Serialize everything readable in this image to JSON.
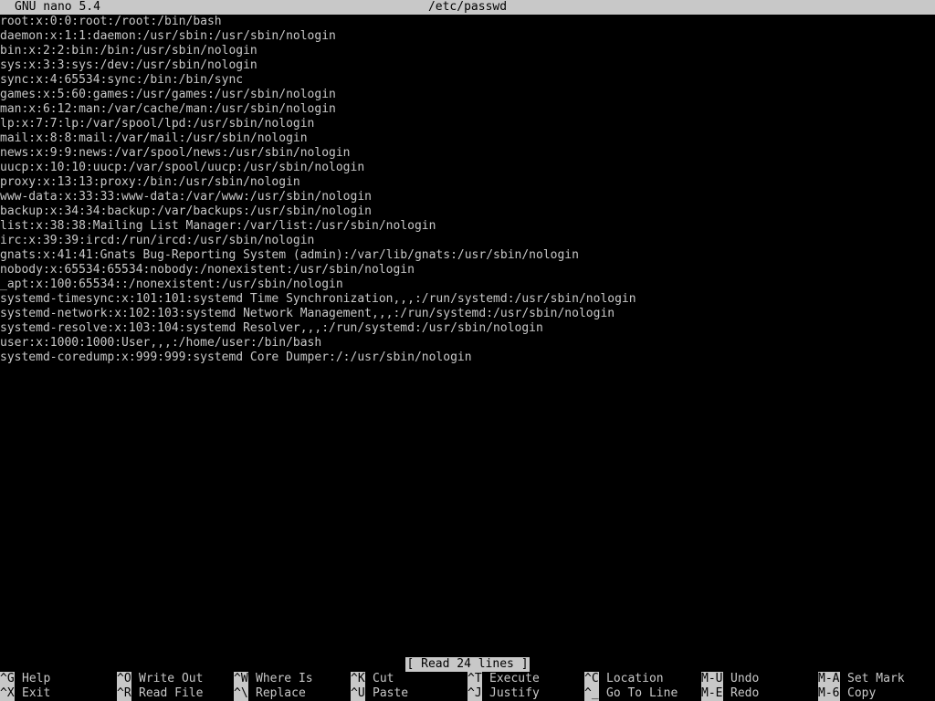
{
  "titlebar": {
    "app": "GNU nano 5.4",
    "file": "/etc/passwd"
  },
  "lines": [
    "root:x:0:0:root:/root:/bin/bash",
    "daemon:x:1:1:daemon:/usr/sbin:/usr/sbin/nologin",
    "bin:x:2:2:bin:/bin:/usr/sbin/nologin",
    "sys:x:3:3:sys:/dev:/usr/sbin/nologin",
    "sync:x:4:65534:sync:/bin:/bin/sync",
    "games:x:5:60:games:/usr/games:/usr/sbin/nologin",
    "man:x:6:12:man:/var/cache/man:/usr/sbin/nologin",
    "lp:x:7:7:lp:/var/spool/lpd:/usr/sbin/nologin",
    "mail:x:8:8:mail:/var/mail:/usr/sbin/nologin",
    "news:x:9:9:news:/var/spool/news:/usr/sbin/nologin",
    "uucp:x:10:10:uucp:/var/spool/uucp:/usr/sbin/nologin",
    "proxy:x:13:13:proxy:/bin:/usr/sbin/nologin",
    "www-data:x:33:33:www-data:/var/www:/usr/sbin/nologin",
    "backup:x:34:34:backup:/var/backups:/usr/sbin/nologin",
    "list:x:38:38:Mailing List Manager:/var/list:/usr/sbin/nologin",
    "irc:x:39:39:ircd:/run/ircd:/usr/sbin/nologin",
    "gnats:x:41:41:Gnats Bug-Reporting System (admin):/var/lib/gnats:/usr/sbin/nologin",
    "nobody:x:65534:65534:nobody:/nonexistent:/usr/sbin/nologin",
    "_apt:x:100:65534::/nonexistent:/usr/sbin/nologin",
    "systemd-timesync:x:101:101:systemd Time Synchronization,,,:/run/systemd:/usr/sbin/nologin",
    "systemd-network:x:102:103:systemd Network Management,,,:/run/systemd:/usr/sbin/nologin",
    "systemd-resolve:x:103:104:systemd Resolver,,,:/run/systemd:/usr/sbin/nologin",
    "user:x:1000:1000:User,,,:/home/user:/bin/bash",
    "systemd-coredump:x:999:999:systemd Core Dumper:/:/usr/sbin/nologin"
  ],
  "status": "[ Read 24 lines ]",
  "shortcuts": [
    [
      {
        "key": "^G",
        "label": "Help"
      },
      {
        "key": "^O",
        "label": "Write Out"
      },
      {
        "key": "^W",
        "label": "Where Is"
      },
      {
        "key": "^K",
        "label": "Cut"
      },
      {
        "key": "^T",
        "label": "Execute"
      },
      {
        "key": "^C",
        "label": "Location"
      },
      {
        "key": "M-U",
        "label": "Undo"
      },
      {
        "key": "M-A",
        "label": "Set Mark"
      }
    ],
    [
      {
        "key": "^X",
        "label": "Exit"
      },
      {
        "key": "^R",
        "label": "Read File"
      },
      {
        "key": "^\\",
        "label": "Replace"
      },
      {
        "key": "^U",
        "label": "Paste"
      },
      {
        "key": "^J",
        "label": "Justify"
      },
      {
        "key": "^_",
        "label": "Go To Line"
      },
      {
        "key": "M-E",
        "label": "Redo"
      },
      {
        "key": "M-6",
        "label": "Copy"
      }
    ]
  ]
}
